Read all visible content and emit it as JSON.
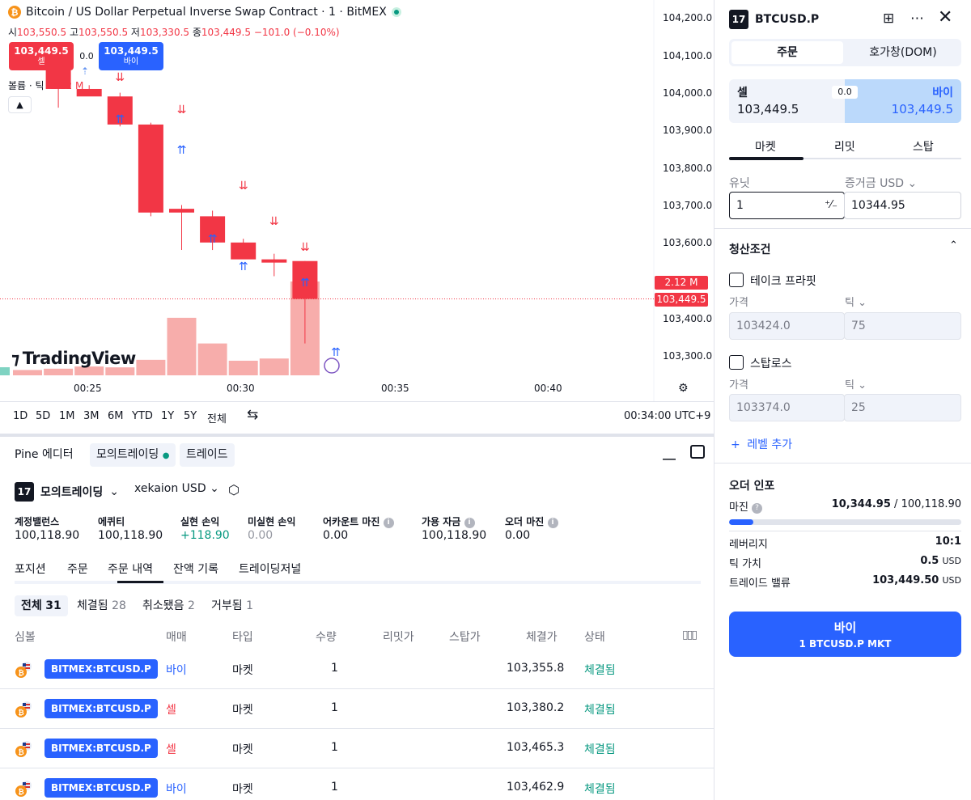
{
  "chart": {
    "symbol_title": "Bitcoin / US Dollar Perpetual Inverse Swap Contract · 1 · BitMEX",
    "ohlc": {
      "o_label": "시",
      "o": "103,550.5",
      "h_label": "고",
      "h": "103,550.5",
      "l_label": "저",
      "l": "103,330.5",
      "c_label": "종",
      "c": "103,449.5",
      "change": "−101.0 (−0.10%)"
    },
    "sell_price": "103,449.5",
    "sell_label": "셀",
    "spread": "0.0",
    "buy_price": "103,449.5",
    "buy_label": "바이",
    "volume_label": "볼륨 · 틱",
    "volume_value": "2.12 M",
    "collapse_icon": "chevron-up-icon",
    "logo_text": "TradingView",
    "price_axis": [
      "104,200.0",
      "104,100.0",
      "104,000.0",
      "103,900.0",
      "103,800.0",
      "103,700.0",
      "103,600.0",
      "103,400.0",
      "103,300.0"
    ],
    "volume_tag": "2.12 M",
    "last_price_tag": "103,449.5",
    "time_axis": [
      "00:25",
      "00:30",
      "00:35",
      "00:40"
    ],
    "colors": {
      "up": "#089981",
      "down": "#f23645",
      "volume_down": "#f7a9a7",
      "accent": "#2962ff"
    }
  },
  "chart_data": {
    "type": "candlestick",
    "x": [
      "00:24",
      "00:25",
      "00:26",
      "00:27",
      "00:28",
      "00:29",
      "00:30",
      "00:31",
      "00:32",
      "00:33"
    ],
    "open": [
      104120,
      104070,
      104010,
      103990,
      103915,
      103690,
      103670,
      103600,
      103555,
      103550.5
    ],
    "high": [
      104125,
      104090,
      104020,
      104000,
      103920,
      103700,
      103685,
      103610,
      103570,
      103550.5
    ],
    "low": [
      104060,
      103960,
      104000,
      103910,
      103670,
      103580,
      103580,
      103565,
      103510,
      103330.5
    ],
    "close": [
      104080,
      104010,
      103990,
      103915,
      103680,
      103680,
      103600,
      103555,
      103550,
      103449.5
    ],
    "ylim": [
      103280,
      104220
    ],
    "volume_ylim": [
      0,
      2.12
    ]
  },
  "rangebar": {
    "ranges": [
      "1D",
      "5D",
      "1M",
      "3M",
      "6M",
      "YTD",
      "1Y",
      "5Y",
      "전체"
    ],
    "time": "00:34:00 UTC+9"
  },
  "panel": {
    "tabs": [
      "Pine 에디터",
      "모의트레이딩",
      "트레이드"
    ],
    "account_name": "모의트레이딩",
    "account_user": "xekaion USD",
    "stats": [
      {
        "label": "계정밸런스",
        "value": "100,118.90"
      },
      {
        "label": "에퀴티",
        "value": "100,118.90"
      },
      {
        "label": "실현 손익",
        "value": "+118.90"
      },
      {
        "label": "미실현 손익",
        "value": "0.00"
      },
      {
        "label": "어카운트 마진",
        "value": "0.00"
      },
      {
        "label": "가용 자금",
        "value": "100,118.90"
      },
      {
        "label": "오더 마진",
        "value": "0.00"
      }
    ],
    "subtabs": [
      "포지션",
      "주문",
      "주문 내역",
      "잔액 기록",
      "트레이딩저널"
    ],
    "filters": [
      "전체",
      "31",
      "체결됨",
      "28",
      "취소됐음",
      "2",
      "거부됨",
      "1"
    ],
    "columns": [
      "심볼",
      "매매",
      "타입",
      "수량",
      "리밋가",
      "스탑가",
      "체결가",
      "상태"
    ],
    "rows": [
      {
        "symbol": "BITMEX:BTCUSD.P",
        "side": "바이",
        "type": "마켓",
        "qty": "1",
        "price": "103,355.8",
        "status": "체결됨"
      },
      {
        "symbol": "BITMEX:BTCUSD.P",
        "side": "셀",
        "type": "마켓",
        "qty": "1",
        "price": "103,380.2",
        "status": "체결됨"
      },
      {
        "symbol": "BITMEX:BTCUSD.P",
        "side": "셀",
        "type": "마켓",
        "qty": "1",
        "price": "103,465.3",
        "status": "체결됨"
      },
      {
        "symbol": "BITMEX:BTCUSD.P",
        "side": "바이",
        "type": "마켓",
        "qty": "1",
        "price": "103,462.9",
        "status": "체결됨"
      }
    ]
  },
  "order": {
    "symbol": "BTCUSD.P",
    "tab_order": "주문",
    "tab_dom": "호가창(DOM)",
    "sell_label": "셀",
    "sell_price": "103,449.5",
    "spread": "0.0",
    "buy_label": "바이",
    "buy_price": "103,449.5",
    "types": [
      "마켓",
      "리밋",
      "스탑"
    ],
    "units_label": "유닛",
    "margin_label": "증거금 USD",
    "units_value": "1",
    "margin_value": "10344.95",
    "exit_title": "청산조건",
    "take_profit": "테이크 프라핏",
    "stop_loss": "스탑로스",
    "price_label": "가격",
    "tick_label": "틱",
    "tp_price": "103424.0",
    "tp_ticks": "75",
    "sl_price": "103374.0",
    "sl_ticks": "25",
    "add_level": "레벨 추가",
    "info_title": "오더 인포",
    "margin_row_label": "마진",
    "margin_row_value": "10,344.95",
    "margin_row_total": "100,118.90",
    "margin_fraction": 0.103,
    "leverage_label": "레버리지",
    "leverage": "10:1",
    "tick_value_label": "틱 가치",
    "tick_value": "0.5",
    "usd": "USD",
    "trade_value_label": "트레이드 밸류",
    "trade_value": "103,449.50",
    "buy_btn_label": "바이",
    "buy_btn_sub": "1 BTCUSD.P MKT"
  }
}
